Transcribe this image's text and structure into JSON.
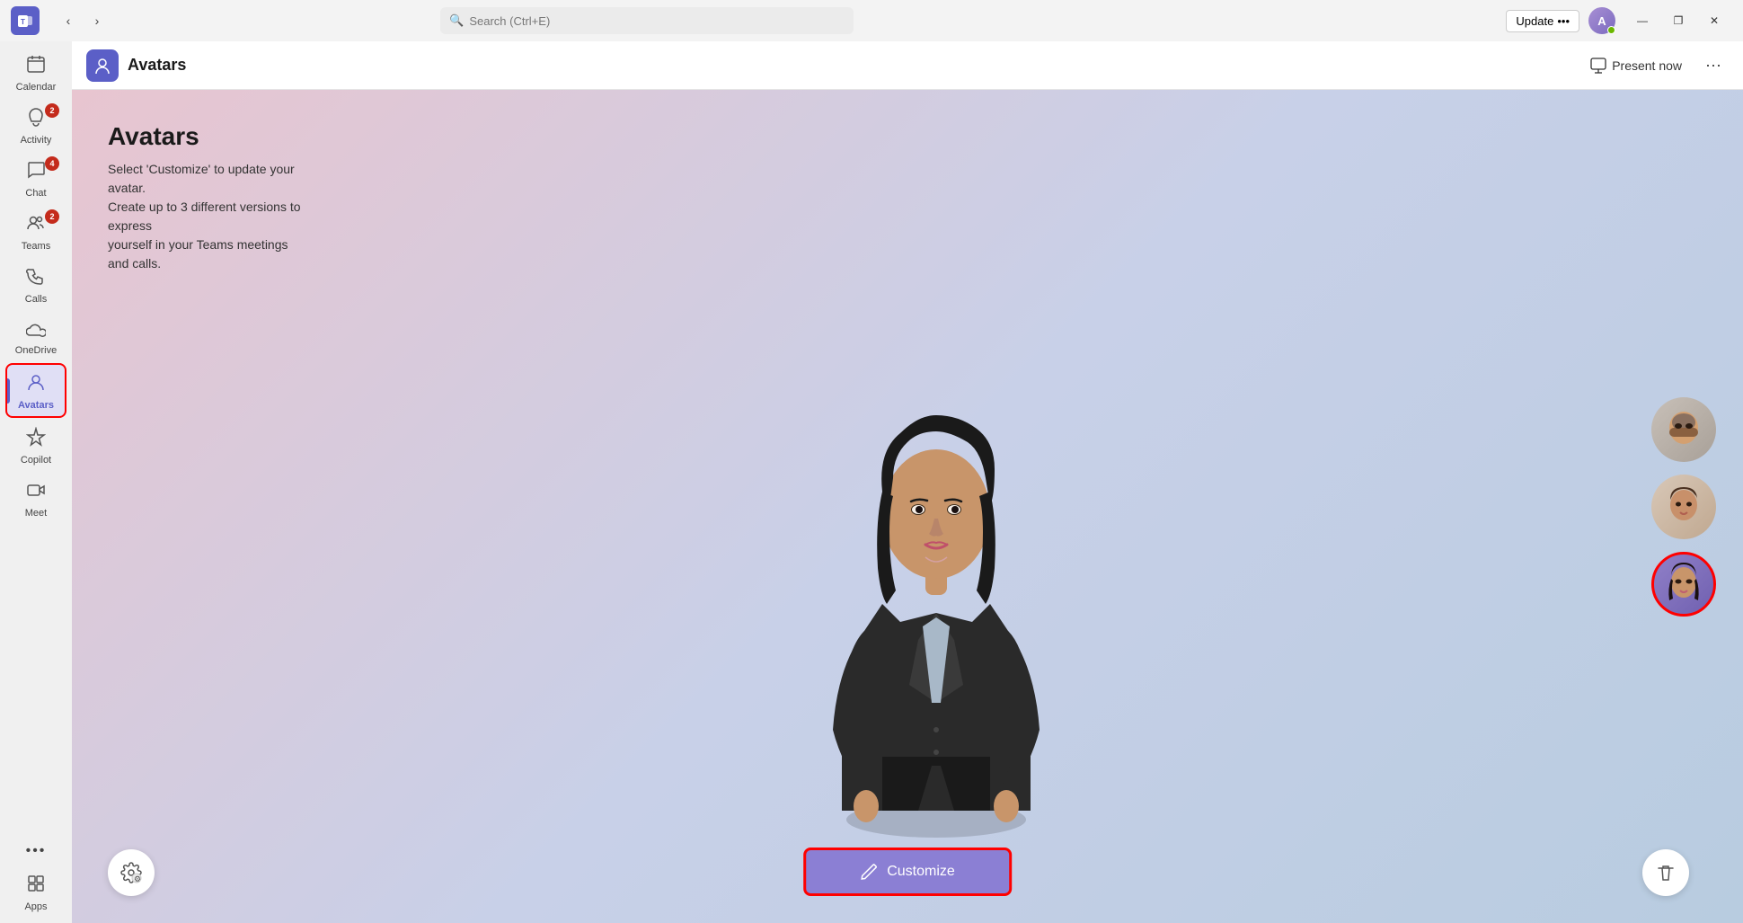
{
  "titlebar": {
    "logo": "T",
    "search_placeholder": "Search (Ctrl+E)",
    "update_label": "Update",
    "update_dots": "•••",
    "back_arrow": "‹",
    "forward_arrow": "›",
    "minimize": "—",
    "maximize": "❐",
    "close": "✕"
  },
  "sidebar": {
    "items": [
      {
        "id": "calendar",
        "label": "Calendar",
        "icon": "📅",
        "badge": null
      },
      {
        "id": "activity",
        "label": "Activity",
        "icon": "🔔",
        "badge": "2"
      },
      {
        "id": "chat",
        "label": "Chat",
        "icon": "💬",
        "badge": "4"
      },
      {
        "id": "teams",
        "label": "Teams",
        "icon": "👥",
        "badge": "2"
      },
      {
        "id": "calls",
        "label": "Calls",
        "icon": "📞",
        "badge": null
      },
      {
        "id": "onedrive",
        "label": "OneDrive",
        "icon": "☁",
        "badge": null
      },
      {
        "id": "avatars",
        "label": "Avatars",
        "icon": "👤",
        "badge": null,
        "active": true
      },
      {
        "id": "copilot",
        "label": "Copilot",
        "icon": "⧉",
        "badge": null
      },
      {
        "id": "meet",
        "label": "Meet",
        "icon": "🎥",
        "badge": null
      },
      {
        "id": "more",
        "label": "···",
        "icon": "···",
        "badge": null
      },
      {
        "id": "apps",
        "label": "Apps",
        "icon": "＋",
        "badge": null
      }
    ]
  },
  "app_header": {
    "icon": "👤",
    "title": "Avatars",
    "present_label": "Present now",
    "more": "···"
  },
  "avatar_page": {
    "heading": "Avatars",
    "description_line1": "Select 'Customize' to update your avatar.",
    "description_line2": "Create up to 3 different versions to express",
    "description_line3": "yourself in your Teams meetings and calls.",
    "customize_label": "Customize",
    "settings_icon": "⚙",
    "delete_icon": "🗑",
    "pencil_icon": "✏"
  },
  "avatar_thumbs": [
    {
      "id": "avatar1",
      "selected": false,
      "color": "#888"
    },
    {
      "id": "avatar2",
      "selected": false,
      "color": "#a0826d"
    },
    {
      "id": "avatar3",
      "selected": true,
      "color": "#7b6abf"
    }
  ],
  "colors": {
    "accent": "#5b5fc7",
    "sidebar_active_bg": "#e0dff5",
    "customize_btn": "#8b7fd4",
    "selected_border": "#ff0000"
  }
}
